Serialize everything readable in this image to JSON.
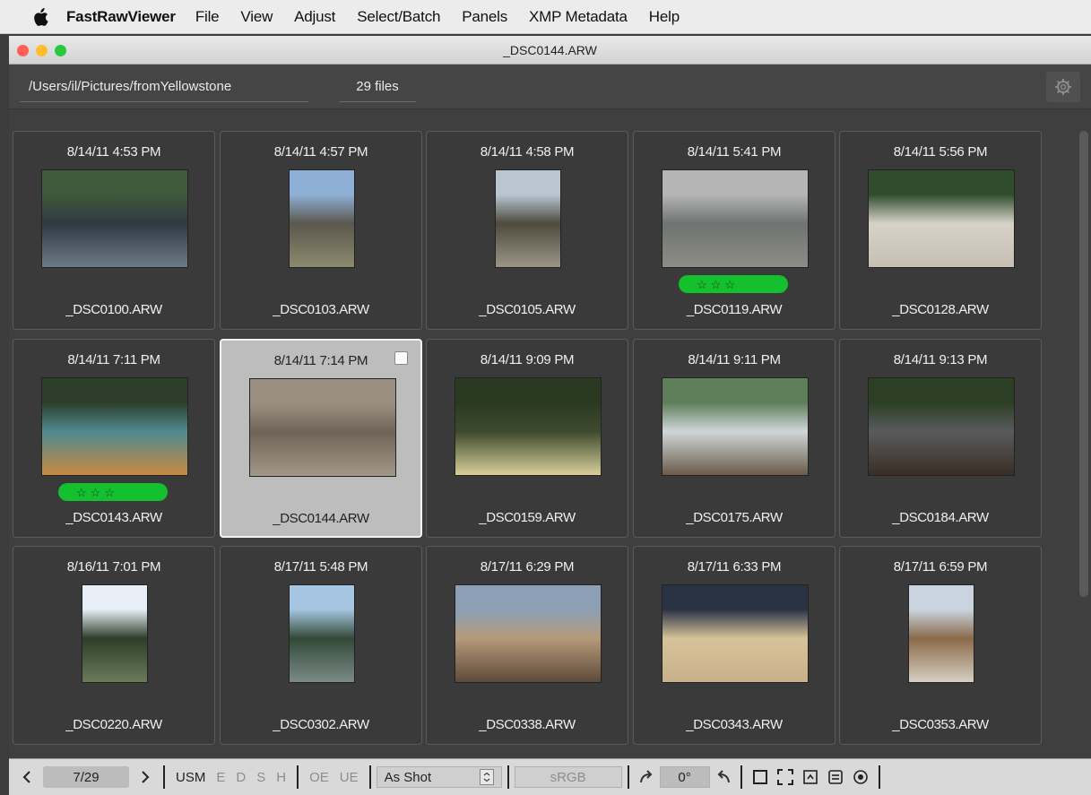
{
  "menubar": {
    "app_name": "FastRawViewer",
    "items": [
      "File",
      "View",
      "Adjust",
      "Select/Batch",
      "Panels",
      "XMP Metadata",
      "Help"
    ]
  },
  "window": {
    "title": "_DSC0144.ARW",
    "traffic_colors": [
      "#fe5f57",
      "#febc2e",
      "#28c840"
    ]
  },
  "pathbar": {
    "path": "/Users/il/Pictures/fromYellowstone",
    "file_count": "29 files"
  },
  "icons": {
    "apple": "apple-icon",
    "settings": "gear-icon",
    "prev": "chevron-left-icon",
    "next": "chevron-right-icon",
    "rotate_cw": "rotate-right-icon",
    "rotate_ccw": "rotate-left-icon",
    "dropdown": "dropdown-icon",
    "view_single": "square-icon",
    "view_fullscreen": "fullscreen-icon",
    "view_grid": "grid-icon",
    "view_info": "info-panel-icon",
    "view_histogram": "globe-icon",
    "star": "star-icon"
  },
  "colors": {
    "rating": "#14c02e",
    "selected_card": "#bdbdbd"
  },
  "files": [
    {
      "time": "8/14/11 4:53 PM",
      "name": "_DSC0100.ARW",
      "rating": 0,
      "orientation": "landscape",
      "selected": false
    },
    {
      "time": "8/14/11 4:57 PM",
      "name": "_DSC0103.ARW",
      "rating": 0,
      "orientation": "portrait",
      "selected": false
    },
    {
      "time": "8/14/11 4:58 PM",
      "name": "_DSC0105.ARW",
      "rating": 0,
      "orientation": "portrait",
      "selected": false
    },
    {
      "time": "8/14/11 5:41 PM",
      "name": "_DSC0119.ARW",
      "rating": 3,
      "orientation": "landscape",
      "selected": false
    },
    {
      "time": "8/14/11 5:56 PM",
      "name": "_DSC0128.ARW",
      "rating": 0,
      "orientation": "landscape",
      "selected": false
    },
    {
      "time": "8/14/11 7:11 PM",
      "name": "_DSC0143.ARW",
      "rating": 3,
      "orientation": "landscape",
      "selected": false
    },
    {
      "time": "8/14/11 7:14 PM",
      "name": "_DSC0144.ARW",
      "rating": 0,
      "orientation": "landscape",
      "selected": true
    },
    {
      "time": "8/14/11 9:09 PM",
      "name": "_DSC0159.ARW",
      "rating": 0,
      "orientation": "landscape",
      "selected": false
    },
    {
      "time": "8/14/11 9:11 PM",
      "name": "_DSC0175.ARW",
      "rating": 0,
      "orientation": "landscape",
      "selected": false
    },
    {
      "time": "8/14/11 9:13 PM",
      "name": "_DSC0184.ARW",
      "rating": 0,
      "orientation": "landscape",
      "selected": false
    },
    {
      "time": "8/16/11 7:01 PM",
      "name": "_DSC0220.ARW",
      "rating": 0,
      "orientation": "portrait",
      "selected": false
    },
    {
      "time": "8/17/11 5:48 PM",
      "name": "_DSC0302.ARW",
      "rating": 0,
      "orientation": "portrait",
      "selected": false
    },
    {
      "time": "8/17/11 6:29 PM",
      "name": "_DSC0338.ARW",
      "rating": 0,
      "orientation": "landscape",
      "selected": false
    },
    {
      "time": "8/17/11 6:33 PM",
      "name": "_DSC0343.ARW",
      "rating": 0,
      "orientation": "landscape",
      "selected": false
    },
    {
      "time": "8/17/11 6:59 PM",
      "name": "_DSC0353.ARW",
      "rating": 0,
      "orientation": "portrait",
      "selected": false
    }
  ],
  "thumb_colors": [
    [
      "#3f5a3a",
      "#2e3944",
      "#6e7a86"
    ],
    [
      "#8fb0d6",
      "#5b574d",
      "#8c8a6e"
    ],
    [
      "#b9c6d2",
      "#4e4a3e",
      "#9c9585"
    ],
    [
      "#b5b5b5",
      "#6f7471",
      "#8d8c87"
    ],
    [
      "#2f4d2c",
      "#d7d2c8",
      "#c7bfb3"
    ],
    [
      "#2c3e2a",
      "#4f8a8f",
      "#c78a42"
    ],
    [
      "#9b8f80",
      "#6e6558",
      "#a19888"
    ],
    [
      "#2a3a22",
      "#3e4a2e",
      "#d8cf9a"
    ],
    [
      "#5f7f5a",
      "#cfd6d8",
      "#6b5b4a"
    ],
    [
      "#2c3f25",
      "#5a5a5e",
      "#3a2e25"
    ],
    [
      "#e7eef5",
      "#2e3d2a",
      "#6a7b58"
    ],
    [
      "#a6c5e0",
      "#334a38",
      "#7b8a88"
    ],
    [
      "#8c9fb5",
      "#b59a7a",
      "#5d4a3a"
    ],
    [
      "#2a3344",
      "#d7c39a",
      "#c7b08a"
    ],
    [
      "#c9d4e0",
      "#8a6a4a",
      "#d7cfc3"
    ]
  ],
  "bottombar": {
    "page": "7/29",
    "usm": "USM",
    "e": "E",
    "d": "D",
    "s": "S",
    "h": "H",
    "oe": "OE",
    "ue": "UE",
    "white_balance": "As Shot",
    "color_profile": "sRGB",
    "rotation": "0°"
  }
}
